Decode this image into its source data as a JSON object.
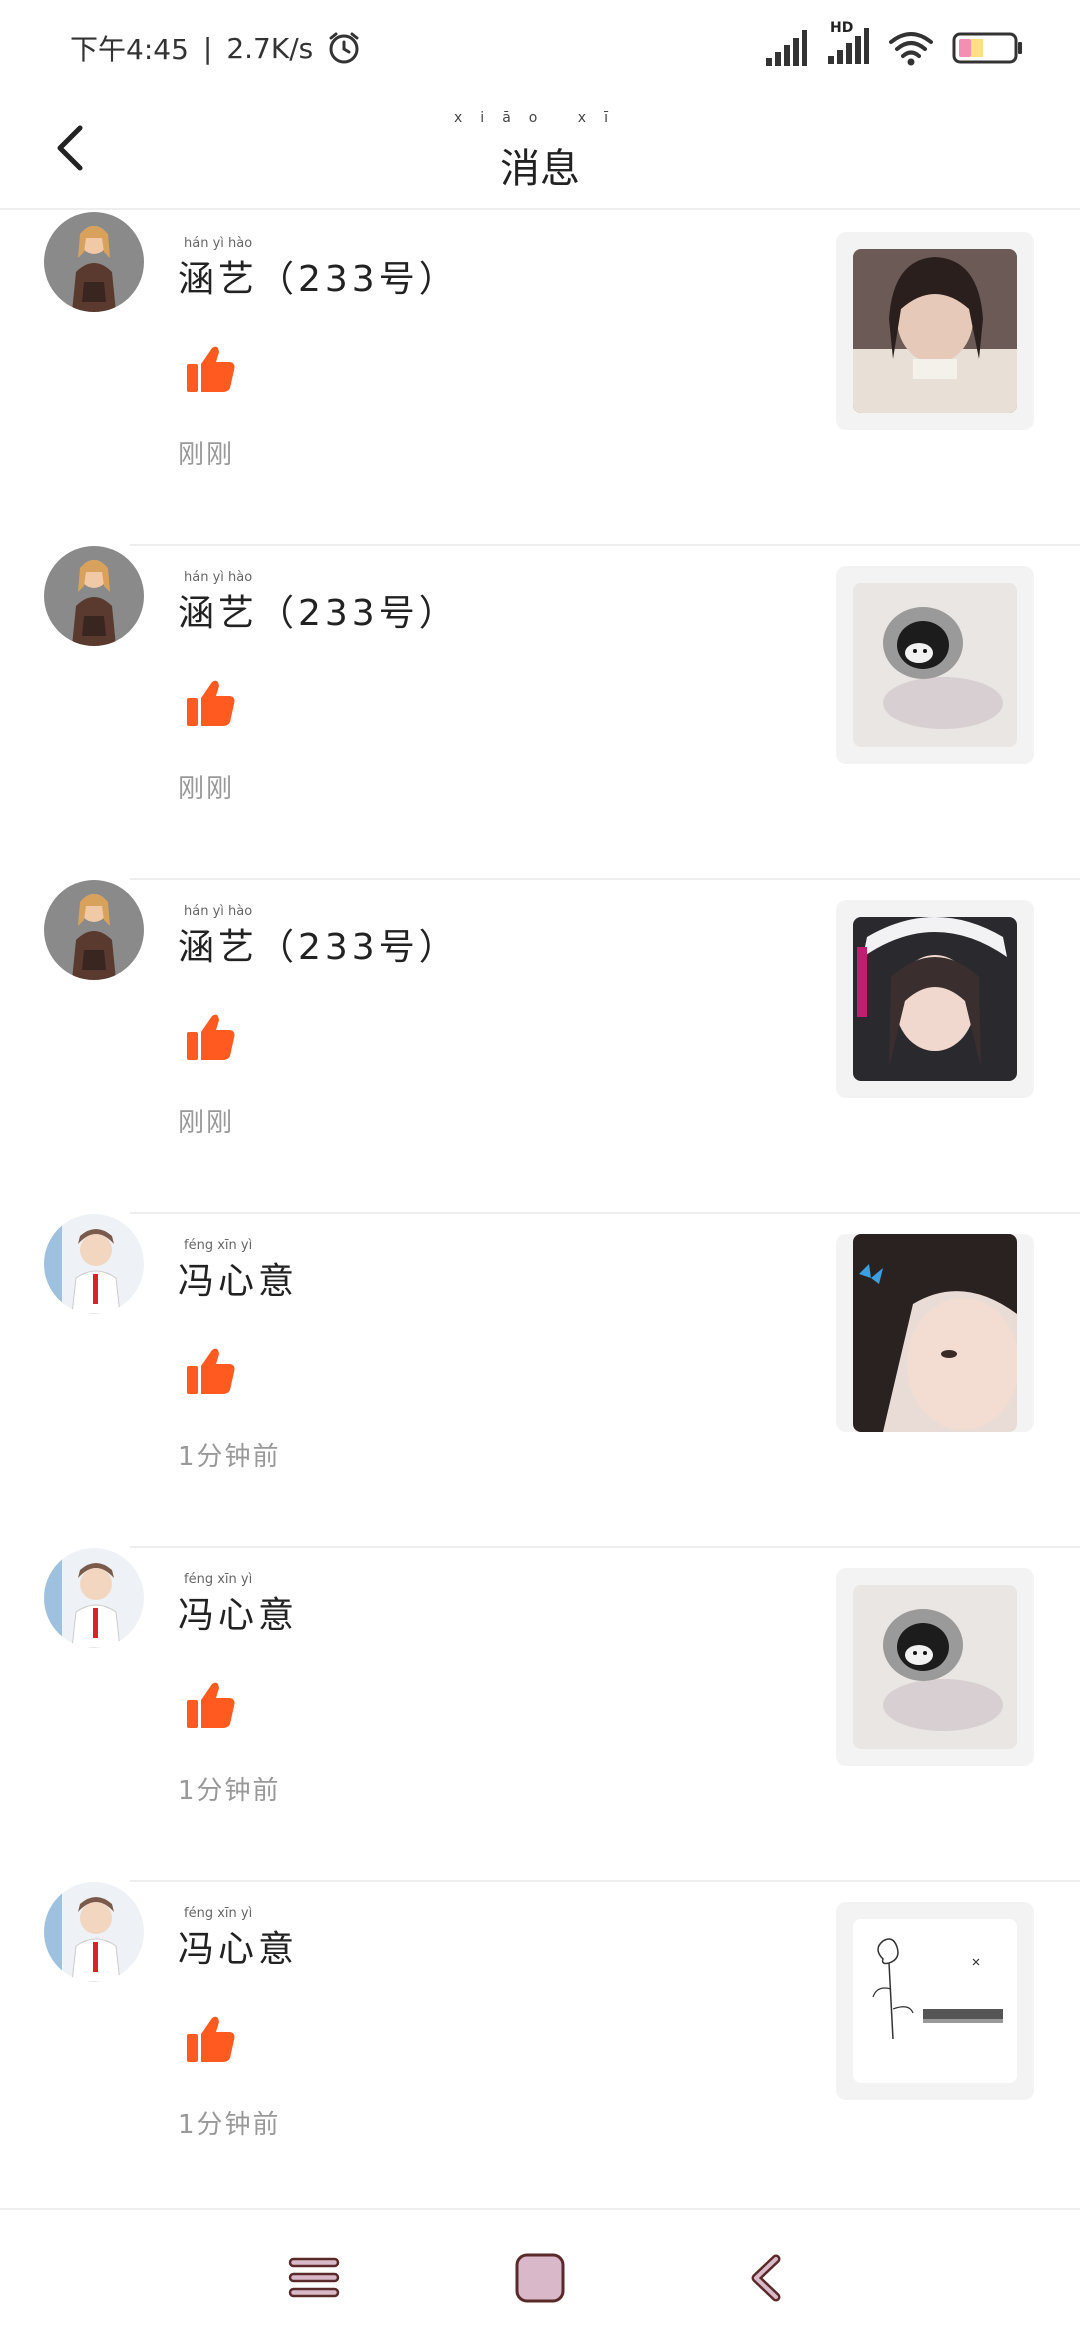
{
  "status_bar": {
    "time": "下午4:45",
    "speed": "2.7K/s",
    "hd_label": "HD"
  },
  "header": {
    "title": "消息",
    "title_pinyin": "xiāo xī"
  },
  "notifications": [
    {
      "name": "涵艺（233号）",
      "name_pinyin": "hán yì hào",
      "time": "刚刚",
      "avatar": "girl",
      "thumb": "portrait-dark"
    },
    {
      "name": "涵艺（233号）",
      "name_pinyin": "hán yì hào",
      "time": "刚刚",
      "avatar": "girl",
      "thumb": "kuromi-keychain"
    },
    {
      "name": "涵艺（233号）",
      "name_pinyin": "hán yì hào",
      "time": "刚刚",
      "avatar": "girl",
      "thumb": "portrait-hat"
    },
    {
      "name": "冯心意",
      "name_pinyin": "féng xīn yì",
      "time": "1分钟前",
      "avatar": "boy",
      "thumb": "portrait-butterfly"
    },
    {
      "name": "冯心意",
      "name_pinyin": "féng xīn yì",
      "time": "1分钟前",
      "avatar": "boy",
      "thumb": "kuromi-keychain"
    },
    {
      "name": "冯心意",
      "name_pinyin": "féng xīn yì",
      "time": "1分钟前",
      "avatar": "boy",
      "thumb": "rose-sketch"
    }
  ],
  "colors": {
    "like": "#ff5a1f",
    "divider": "#eeeeee",
    "nav_square": "#d9b8c9",
    "nav_stroke": "#5a2a2a"
  },
  "icons": {
    "back": "chevron-left-icon",
    "like": "thumbs-up-icon",
    "nav_menu": "menu-icon",
    "nav_home": "square-icon",
    "nav_back": "back-arrow-icon"
  }
}
